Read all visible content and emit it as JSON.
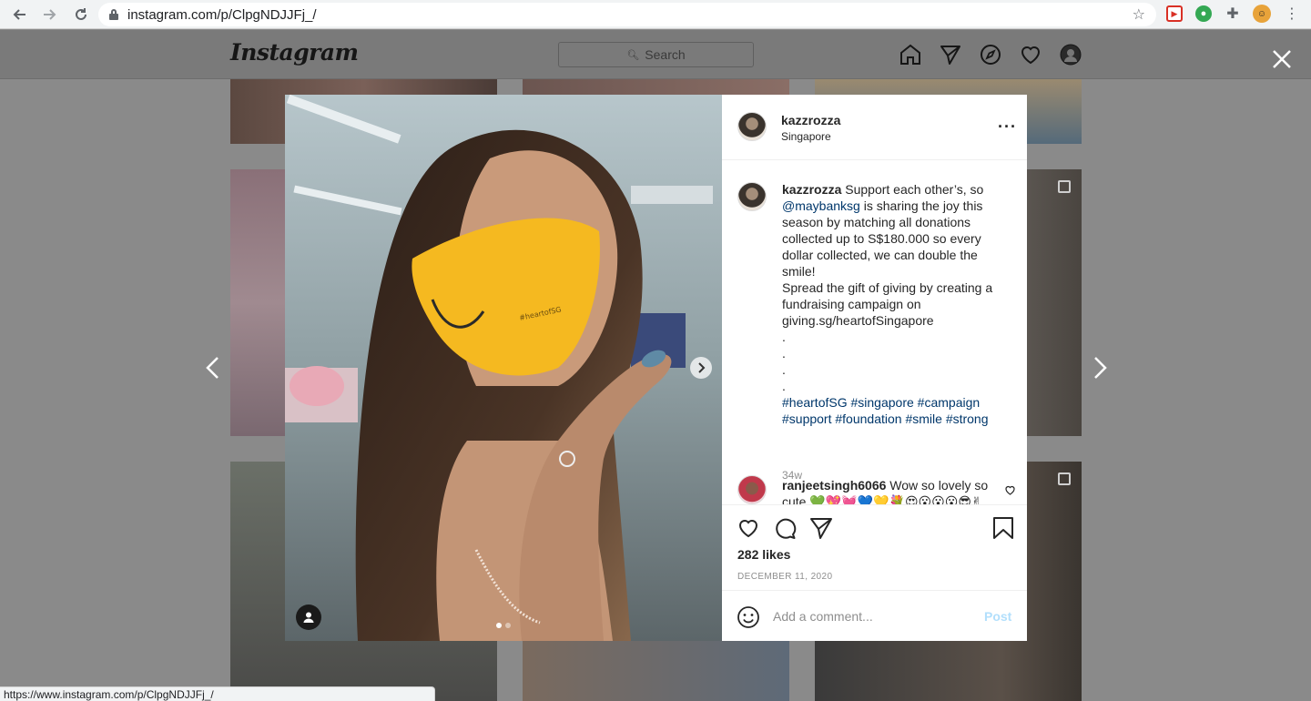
{
  "browser": {
    "url": "instagram.com/p/ClpgNDJJFj_/",
    "status_url": "https://www.instagram.com/p/ClpgNDJJFj_/"
  },
  "ig_header": {
    "logo": "Instagram",
    "search_placeholder": "Search",
    "nav_icons": [
      "home-icon",
      "direct-icon",
      "explore-icon",
      "activity-heart-icon",
      "profile-avatar"
    ]
  },
  "post": {
    "mask_text": "#heartofSG",
    "carousel_dots": 2,
    "author": {
      "username": "kazzrozza",
      "location": "Singapore"
    },
    "caption": {
      "username": "kazzrozza",
      "text_1": "Support each other’s, so",
      "mention": "@maybanksg",
      "text_2": "is sharing the joy this season by matching all donations collected up to S$180.000 so every dollar collected, we can double the smile!",
      "text_3": "Spread the gift of giving by creating a fundraising campaign on giving.sg/heartofSingapore",
      "dots": [
        ".",
        ".",
        ".",
        "."
      ],
      "hashtags": [
        "#heartofSG",
        "#singapore",
        "#campaign",
        "#support",
        "#foundation",
        "#smile",
        "#strong"
      ],
      "time_ago": "34w"
    },
    "comments": [
      {
        "username": "ranjeetsingh6066",
        "text": "Wow so lovely so cute 💚💖💓💙💛💐😍😮😮😮😎✌"
      }
    ],
    "likes": "282 likes",
    "date": "DECEMBER 11, 2020",
    "add_comment_placeholder": "Add a comment...",
    "post_button": "Post"
  },
  "colors": {
    "link": "#00376b",
    "muted": "#8e8e8e",
    "post_disabled": "#b2dffc",
    "mask_yellow": "#f5b920"
  }
}
